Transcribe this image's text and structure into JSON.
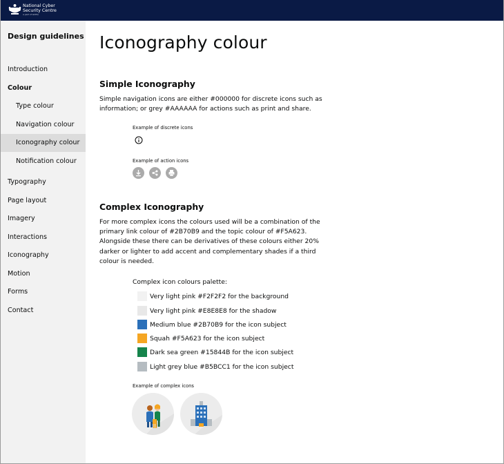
{
  "header": {
    "logo_line1": "National Cyber",
    "logo_line2": "Security Centre",
    "logo_sub": "a part of GCHQ"
  },
  "sidebar": {
    "title": "Design guidelines",
    "items": [
      {
        "label": "Introduction"
      },
      {
        "label": "Colour"
      },
      {
        "label": "Type colour"
      },
      {
        "label": "Navigation colour"
      },
      {
        "label": "Iconography colour"
      },
      {
        "label": "Notification colour"
      },
      {
        "label": "Typography"
      },
      {
        "label": "Page layout"
      },
      {
        "label": "Imagery"
      },
      {
        "label": "Interactions"
      },
      {
        "label": "Iconography"
      },
      {
        "label": "Motion"
      },
      {
        "label": "Forms"
      },
      {
        "label": "Contact"
      }
    ]
  },
  "main": {
    "title": "Iconography colour",
    "simple": {
      "heading": "Simple Iconography",
      "text": "Simple navigation icons are either #000000 for discrete icons such as information; or grey #AAAAAA for actions such as print and share.",
      "discrete_label": "Example of discrete icons",
      "action_label": "Example of action icons",
      "action_icon_color": "#AAAAAA"
    },
    "complex": {
      "heading": "Complex Iconography",
      "text": "For more complex icons the colours used will be a combination of the primary link colour of #2B70B9 and the topic colour of #F5A623. Alongside these there can be derivatives of these colours either 20% darker or lighter to add accent and complementary shades if a third colour is needed.",
      "palette_title": "Complex icon colours palette:",
      "palette": [
        {
          "label": "Very light pink #F2F2F2 for the background",
          "color": "#F2F2F2"
        },
        {
          "label": "Very light pink #E8E8E8 for the shadow",
          "color": "#E8E8E8"
        },
        {
          "label": "Medium blue #2B70B9 for the icon subject",
          "color": "#2B70B9"
        },
        {
          "label": "Squah #F5A623 for the icon subject",
          "color": "#F5A623"
        },
        {
          "label": "Dark sea green #15844B for the icon subject",
          "color": "#15844B"
        },
        {
          "label": "Light grey blue #B5BCC1 for the icon subject",
          "color": "#B5BCC1"
        }
      ],
      "examples_label": "Example of complex icons"
    }
  },
  "colors": {
    "header_bg": "#0A1A45",
    "sidebar_bg": "#F2F2F2",
    "sidebar_active_bg": "#DCDCDC"
  }
}
